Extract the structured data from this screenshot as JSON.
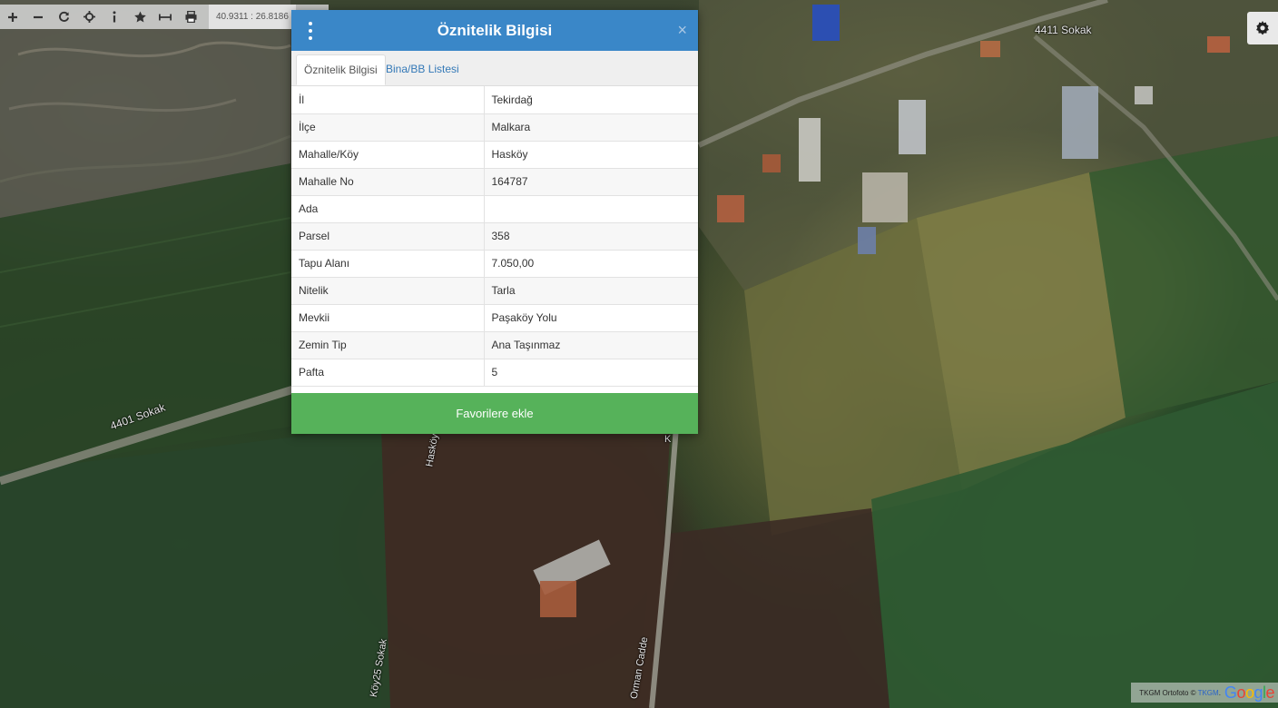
{
  "toolbar": {
    "tools": [
      {
        "name": "zoom-in-icon"
      },
      {
        "name": "zoom-out-icon"
      },
      {
        "name": "refresh-icon"
      },
      {
        "name": "crosshair-icon"
      },
      {
        "name": "info-icon"
      },
      {
        "name": "star-icon"
      },
      {
        "name": "measure-icon"
      },
      {
        "name": "print-icon"
      }
    ],
    "coordinates": "40.9311 : 26.8186"
  },
  "map": {
    "labels": {
      "road_4401": "4401 Sokak",
      "road_4411": "4411 Sokak",
      "road_hasköy": "Hasköy",
      "road_köy25": "Köy25 Sokak",
      "road_orman": "Orman Cadde",
      "road_k": "K"
    }
  },
  "attribution": {
    "text": "TKGM Ortofoto ©",
    "link": "TKGM",
    "google": "Google"
  },
  "modal": {
    "title": "Öznitelik Bilgisi",
    "close": "×",
    "tabs": [
      {
        "label": "Öznitelik Bilgisi",
        "active": true
      },
      {
        "label": "Bina/BB Listesi",
        "active": false
      }
    ],
    "rows": [
      {
        "key": "İl",
        "value": "Tekirdağ"
      },
      {
        "key": "İlçe",
        "value": "Malkara"
      },
      {
        "key": "Mahalle/Köy",
        "value": "Hasköy"
      },
      {
        "key": "Mahalle No",
        "value": "164787"
      },
      {
        "key": "Ada",
        "value": ""
      },
      {
        "key": "Parsel",
        "value": "358"
      },
      {
        "key": "Tapu Alanı",
        "value": "7.050,00"
      },
      {
        "key": "Nitelik",
        "value": "Tarla"
      },
      {
        "key": "Mevkii",
        "value": "Paşaköy Yolu"
      },
      {
        "key": "Zemin Tip",
        "value": "Ana Taşınmaz"
      },
      {
        "key": "Pafta",
        "value": "5"
      }
    ],
    "favorite_button": "Favorilere ekle"
  },
  "colors": {
    "header": "#3a87c8",
    "favorite": "#56b25a",
    "tab_link": "#3479b7"
  }
}
